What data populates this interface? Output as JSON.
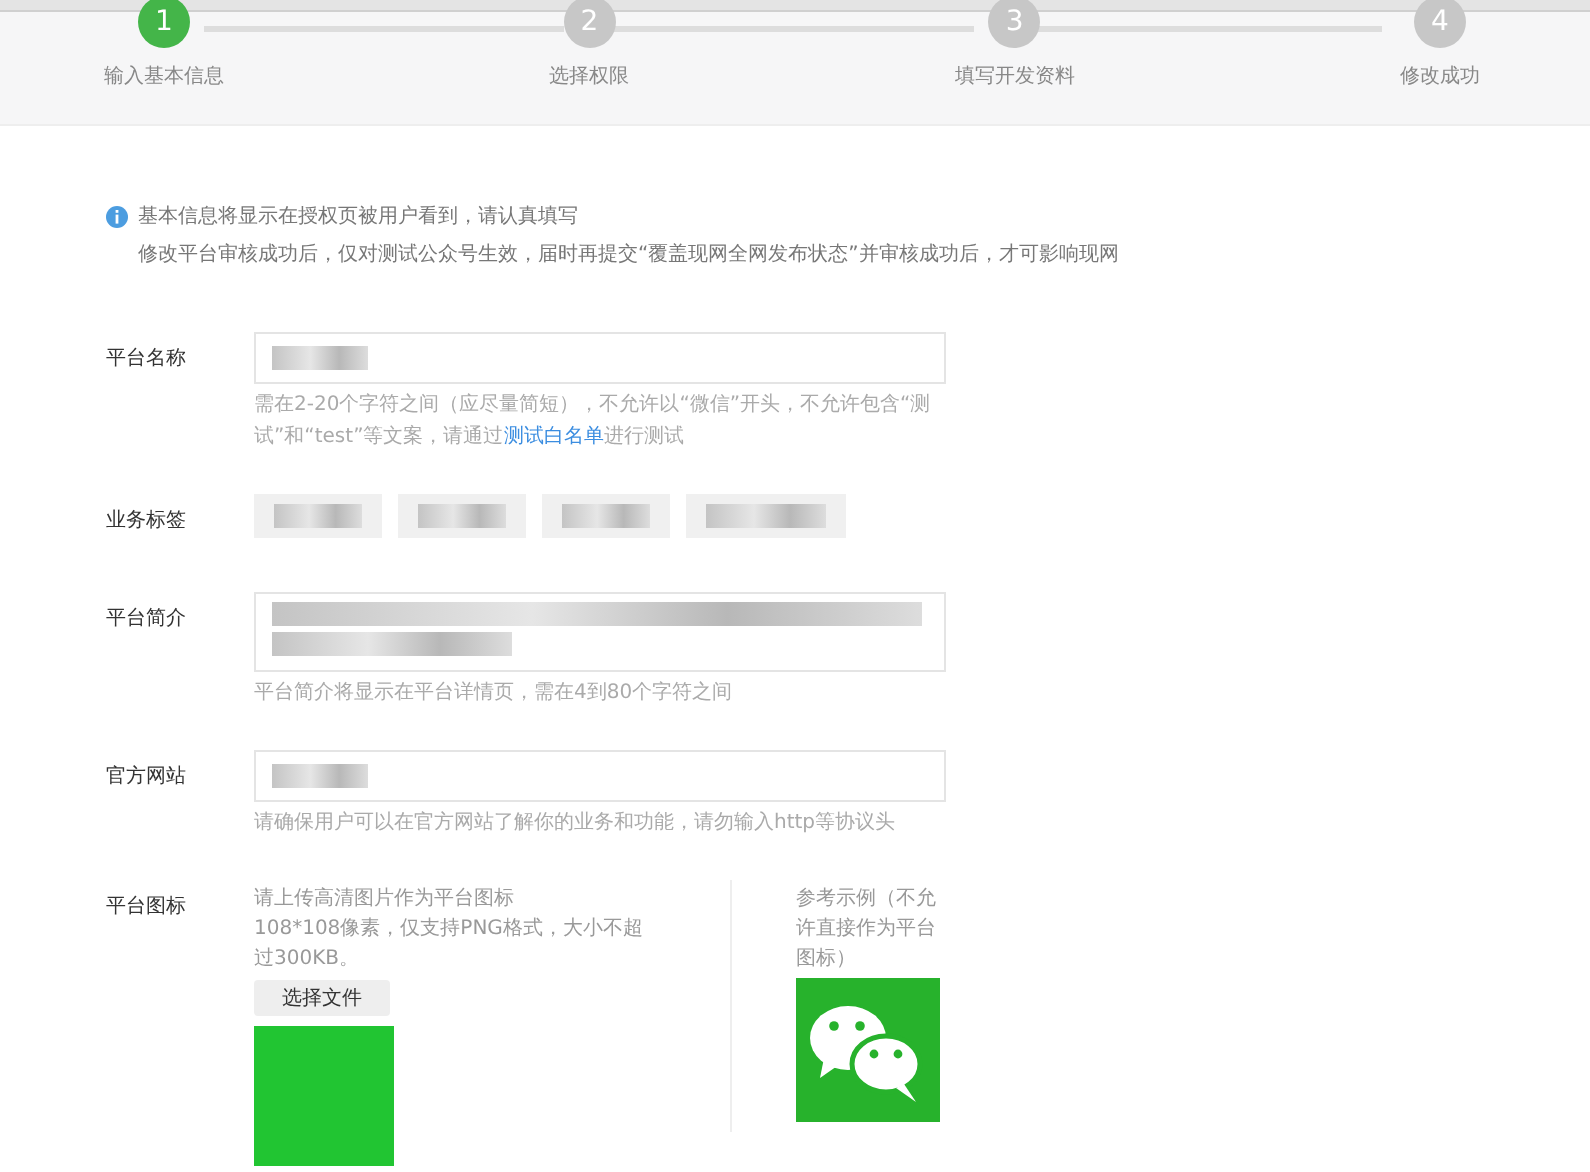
{
  "steps": [
    {
      "number": "1",
      "label": "输入基本信息",
      "active": true
    },
    {
      "number": "2",
      "label": "选择权限",
      "active": false
    },
    {
      "number": "3",
      "label": "填写开发资料",
      "active": false
    },
    {
      "number": "4",
      "label": "修改成功",
      "active": false
    }
  ],
  "notice": {
    "lines": [
      "基本信息将显示在授权页被用户看到，请认真填写",
      "修改平台审核成功后，仅对测试公众号生效，届时再提交“覆盖现网全网发布状态”并审核成功后，才可影响现网"
    ]
  },
  "form": [
    {
      "kind": "input",
      "label": "平台名称",
      "hint": {
        "before": "需在2-20个字符之间（应尽量简短），不允许以“微信”开头，不允许包含“测试”和“test”等文案，请通过",
        "link": "测试白名单",
        "after": "进行测试"
      }
    },
    {
      "kind": "tags",
      "label": "业务标签"
    },
    {
      "kind": "textarea",
      "label": "平台简介",
      "hint": {
        "before": "平台简介将显示在平台详情页，需在4到80个字符之间"
      }
    },
    {
      "kind": "input",
      "label": "官方网站",
      "hint": {
        "before": "请确保用户可以在官方网站了解你的业务和功能，请勿输入http等协议头"
      }
    },
    {
      "kind": "icon",
      "label": "平台图标",
      "upload_lines": [
        "请上传高清图片作为平台图标",
        "108*108像素，仅支持PNG格式，大小不超过300KB。"
      ],
      "button": "选择文件",
      "example": "参考示例（不允许直接作为平台图标）"
    }
  ]
}
